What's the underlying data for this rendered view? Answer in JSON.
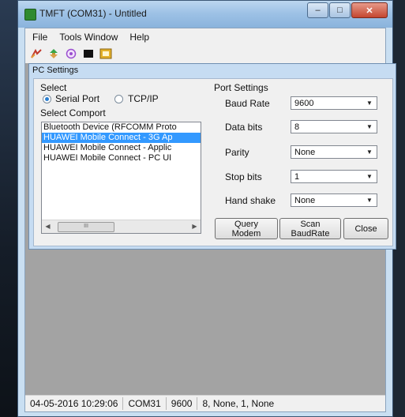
{
  "window": {
    "title": "TMFT (COM31) - Untitled",
    "buttons": {
      "minimize": "–",
      "maximize": "□",
      "close": "✕"
    }
  },
  "menu": [
    "File",
    "Tools Window",
    "Help"
  ],
  "toolbar": [
    "tool-1-icon",
    "tool-2-icon",
    "tool-3-icon",
    "tool-4-icon",
    "tool-5-icon"
  ],
  "dialog": {
    "title": "PC Settings",
    "select_label": "Select",
    "radio_serial": "Serial Port",
    "radio_tcp": "TCP/IP",
    "comport_label": "Select Comport",
    "comports": [
      "Bluetooth Device (RFCOMM Proto",
      "HUAWEI Mobile Connect - 3G Ap",
      "HUAWEI Mobile Connect - Applic",
      "HUAWEI Mobile Connect - PC UI"
    ],
    "selected_index": 1,
    "scroll_thumb": "III",
    "port_settings_label": "Port Settings",
    "baud_rate_label": "Baud Rate",
    "baud_rate": "9600",
    "data_bits_label": "Data bits",
    "data_bits": "8",
    "parity_label": "Parity",
    "parity": "None",
    "stop_bits_label": "Stop bits",
    "stop_bits": "1",
    "handshake_label": "Hand shake",
    "handshake": "None",
    "btn_query_line1": "Query",
    "btn_query_line2": "Modem",
    "btn_scan_line1": "Scan",
    "btn_scan_line2": "BaudRate",
    "btn_close": "Close"
  },
  "status": {
    "datetime": "04-05-2016 10:29:06",
    "port": "COM31",
    "baud": "9600",
    "format": "8, None, 1, None"
  },
  "colors": {
    "selection": "#3399ff",
    "dialog_frame": "#c6dcf2",
    "workspace": "#a3a3a3"
  }
}
